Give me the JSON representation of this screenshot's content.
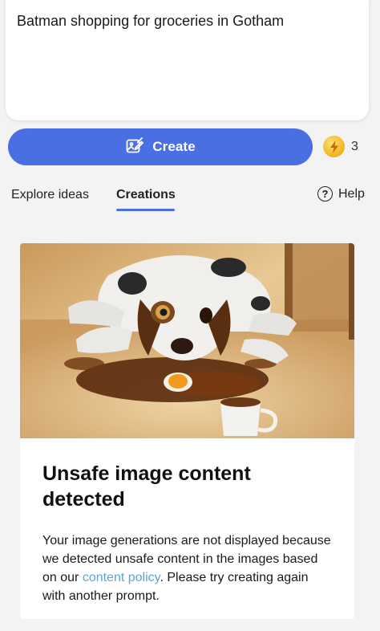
{
  "prompt": {
    "value": "Batman shopping for groceries in Gotham"
  },
  "create_button": {
    "label": "Create"
  },
  "boosts": {
    "count": "3"
  },
  "tabs": [
    {
      "label": "Explore ideas"
    },
    {
      "label": "Creations"
    }
  ],
  "help": {
    "label": "Help",
    "icon_glyph": "?"
  },
  "card": {
    "title": "Unsafe image content detected",
    "message_before": "Your image generations are not displayed because we detected unsafe content in the images based on our ",
    "link_text": "content policy",
    "message_after": ". Please try creating again with another prompt."
  },
  "colors": {
    "accent": "#4a6fe2",
    "link": "#5aa5d8",
    "coin": "#f2b11b"
  },
  "icons": {
    "create": "image-create-icon",
    "boost": "lightning-coin-icon",
    "help": "question-circle-icon"
  }
}
